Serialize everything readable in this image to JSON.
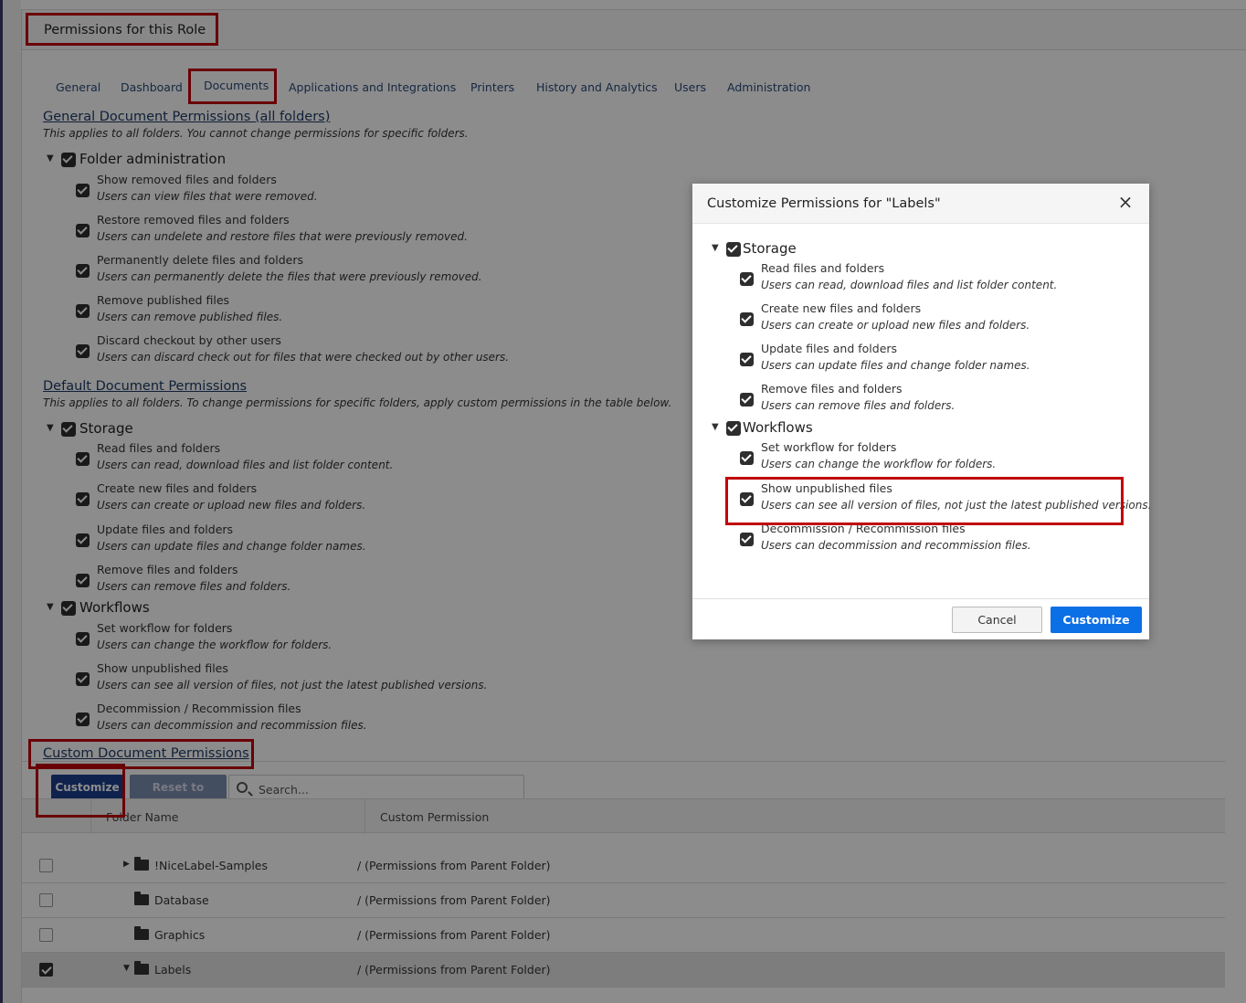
{
  "header": {
    "title": "Permissions for this Role"
  },
  "tabs": [
    {
      "label": "General"
    },
    {
      "label": "Dashboard"
    },
    {
      "label": "Documents"
    },
    {
      "label": "Applications and Integrations"
    },
    {
      "label": "Printers"
    },
    {
      "label": "History and Analytics"
    },
    {
      "label": "Users"
    },
    {
      "label": "Administration"
    }
  ],
  "general": {
    "title": "General Document Permissions (all folders)",
    "subtitle": "This applies to all folders. You cannot change permissions for specific folders.",
    "group": "Folder administration",
    "items": [
      {
        "title": "Show removed files and folders",
        "desc": "Users can view files that were removed."
      },
      {
        "title": "Restore removed files and folders",
        "desc": "Users can undelete and restore files that were previously removed."
      },
      {
        "title": "Permanently delete files and folders",
        "desc": "Users can permanently delete the files that were previously removed."
      },
      {
        "title": "Remove published files",
        "desc": "Users can remove published files."
      },
      {
        "title": "Discard checkout by other users",
        "desc": "Users can discard check out for files that were checked out by other users."
      }
    ]
  },
  "default": {
    "title": "Default Document Permissions",
    "subtitle": "This applies to all folders. To change permissions for specific folders, apply custom permissions in the table below.",
    "storage": {
      "label": "Storage",
      "items": [
        {
          "title": "Read files and folders",
          "desc": "Users can read, download files and list folder content."
        },
        {
          "title": "Create new files and folders",
          "desc": "Users can create or upload new files and folders."
        },
        {
          "title": "Update files and folders",
          "desc": "Users can update files and change folder names."
        },
        {
          "title": "Remove files and folders",
          "desc": "Users can remove files and folders."
        }
      ]
    },
    "workflows": {
      "label": "Workflows",
      "items": [
        {
          "title": "Set workflow for folders",
          "desc": "Users can change the workflow for folders."
        },
        {
          "title": "Show unpublished files",
          "desc": "Users can see all version of files, not just the latest published versions."
        },
        {
          "title": "Decommission / Recommission files",
          "desc": "Users can decommission and recommission files."
        }
      ]
    }
  },
  "custom": {
    "title": "Custom Document Permissions",
    "customize_label": "Customize",
    "reset_label": "Reset to default",
    "search_placeholder": "Search...",
    "columns": {
      "folder": "Folder Name",
      "permission": "Custom Permission"
    },
    "rows": [
      {
        "name": "!NiceLabel-Samples",
        "perm": "/ (Permissions from Parent Folder)"
      },
      {
        "name": "Database",
        "perm": "/ (Permissions from Parent Folder)"
      },
      {
        "name": "Graphics",
        "perm": "/ (Permissions from Parent Folder)"
      },
      {
        "name": "Labels",
        "perm": "/ (Permissions from Parent Folder)"
      }
    ]
  },
  "modal": {
    "title": "Customize Permissions for \"Labels\"",
    "close": "×",
    "cancel": "Cancel",
    "customize": "Customize",
    "storage": {
      "label": "Storage",
      "items": [
        {
          "title": "Read files and folders",
          "desc": "Users can read, download files and list folder content."
        },
        {
          "title": "Create new files and folders",
          "desc": "Users can create or upload new files and folders."
        },
        {
          "title": "Update files and folders",
          "desc": "Users can update files and change folder names."
        },
        {
          "title": "Remove files and folders",
          "desc": "Users can remove files and folders."
        }
      ]
    },
    "workflows": {
      "label": "Workflows",
      "items": [
        {
          "title": "Set workflow for folders",
          "desc": "Users can change the workflow for folders."
        },
        {
          "title": "Show unpublished files",
          "desc": "Users can see all version of files, not just the latest published versions."
        },
        {
          "title": "Decommission / Recommission files",
          "desc": "Users can decommission and recommission files."
        }
      ]
    }
  }
}
